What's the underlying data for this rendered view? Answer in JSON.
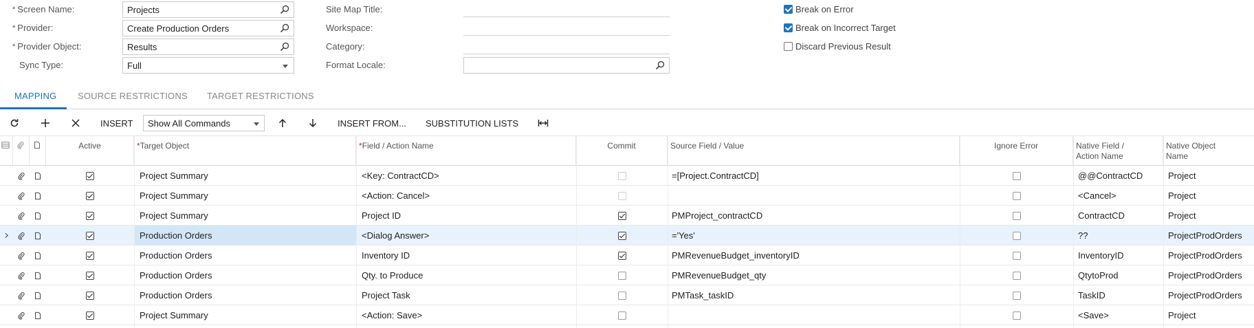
{
  "form": {
    "screen_name": {
      "label": "Screen Name:",
      "value": "Projects"
    },
    "provider": {
      "label": "Provider:",
      "value": "Create Production Orders"
    },
    "provider_object": {
      "label": "Provider Object:",
      "value": "Results"
    },
    "sync_type": {
      "label": "Sync Type:",
      "value": "Full"
    },
    "site_map_title": {
      "label": "Site Map Title:",
      "value": ""
    },
    "workspace": {
      "label": "Workspace:",
      "value": ""
    },
    "category": {
      "label": "Category:",
      "value": ""
    },
    "format_locale": {
      "label": "Format Locale:",
      "value": ""
    },
    "break_on_error": {
      "label": "Break on Error",
      "checked": true
    },
    "break_on_incorrect_target": {
      "label": "Break on Incorrect Target",
      "checked": true
    },
    "discard_previous_result": {
      "label": "Discard Previous Result",
      "checked": false
    }
  },
  "tabs": [
    "MAPPING",
    "SOURCE RESTRICTIONS",
    "TARGET RESTRICTIONS"
  ],
  "toolbar": {
    "insert": "INSERT",
    "commands_select": "Show All Commands",
    "insert_from": "INSERT FROM...",
    "substitution_lists": "SUBSTITUTION LISTS"
  },
  "grid": {
    "headers": {
      "active": "Active",
      "target_object": "Target Object",
      "field_action": "Field / Action Name",
      "commit": "Commit",
      "source_field": "Source Field / Value",
      "ignore_error": "Ignore Error",
      "native_field_1": "Native Field /",
      "native_field_2": "Action Name",
      "native_object_1": "Native Object",
      "native_object_2": "Name"
    },
    "rows": [
      {
        "active": true,
        "target": "Project Summary",
        "field": "<Key: ContractCD>",
        "commit": false,
        "commit_enabled": false,
        "source": "=[Project.ContractCD]",
        "ignore": false,
        "native_field": "@@ContractCD",
        "native_object": "Project"
      },
      {
        "active": true,
        "target": "Project Summary",
        "field": "<Action: Cancel>",
        "commit": false,
        "commit_enabled": false,
        "source": "",
        "ignore": false,
        "native_field": "<Cancel>",
        "native_object": "Project"
      },
      {
        "active": true,
        "target": "Project Summary",
        "field": "Project ID",
        "commit": true,
        "commit_enabled": true,
        "source": "PMProject_contractCD",
        "ignore": false,
        "native_field": "ContractCD",
        "native_object": "Project"
      },
      {
        "active": true,
        "target": "Production Orders",
        "field": "<Dialog Answer>",
        "commit": true,
        "commit_enabled": true,
        "source": "='Yes'",
        "ignore": false,
        "native_field": "??",
        "native_object": "ProjectProdOrders",
        "selected": true
      },
      {
        "active": true,
        "target": "Production Orders",
        "field": "Inventory ID",
        "commit": true,
        "commit_enabled": true,
        "source": "PMRevenueBudget_inventoryID",
        "ignore": false,
        "native_field": "InventoryID",
        "native_object": "ProjectProdOrders"
      },
      {
        "active": true,
        "target": "Production Orders",
        "field": "Qty. to Produce",
        "commit": false,
        "commit_enabled": true,
        "source": "PMRevenueBudget_qty",
        "ignore": false,
        "native_field": "QtytoProd",
        "native_object": "ProjectProdOrders"
      },
      {
        "active": true,
        "target": "Production Orders",
        "field": "Project Task",
        "commit": false,
        "commit_enabled": true,
        "source": "PMTask_taskID",
        "ignore": false,
        "native_field": "TaskID",
        "native_object": "ProjectProdOrders"
      },
      {
        "active": true,
        "target": "Project Summary",
        "field": "<Action: Save>",
        "commit": false,
        "commit_enabled": true,
        "source": "",
        "ignore": false,
        "native_field": "<Save>",
        "native_object": "Project"
      }
    ]
  },
  "colors": {
    "accent": "#1a73c7",
    "selected_row": "#e7f2fc",
    "selected_cell": "#d3e6f8"
  }
}
